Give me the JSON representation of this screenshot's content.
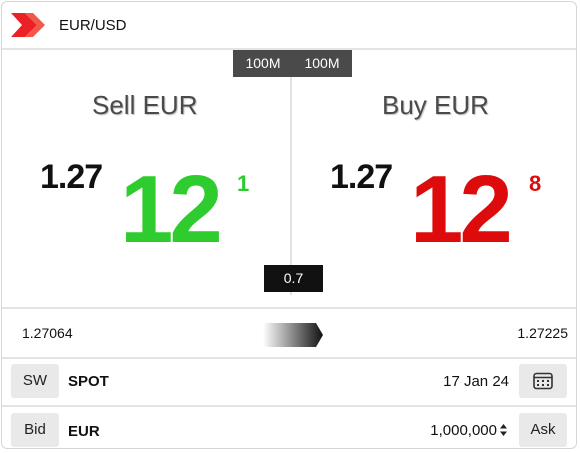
{
  "header": {
    "pair": "EUR/USD"
  },
  "panel": {
    "sell": {
      "notional": "100M",
      "title": "Sell EUR",
      "big_figure": "1.27",
      "pips": "12",
      "tenth_pip": "1"
    },
    "buy": {
      "notional": "100M",
      "title": "Buy EUR",
      "big_figure": "1.27",
      "pips": "12",
      "tenth_pip": "8"
    },
    "spread": "0.7"
  },
  "range": {
    "low": "1.27064",
    "high": "1.27225"
  },
  "tenor": {
    "button_label": "SW",
    "tenor_label": "SPOT",
    "value_date": "17 Jan 24",
    "calendar_icon": "calendar-icon"
  },
  "deal": {
    "bid_label": "Bid",
    "currency": "EUR",
    "amount": "1,000,000",
    "ask_label": "Ask",
    "stepper_icon": "updown-stepper-icon"
  },
  "colors": {
    "sell": "#2ecc2e",
    "buy": "#dd0b0b",
    "brand": "#ec2127"
  }
}
